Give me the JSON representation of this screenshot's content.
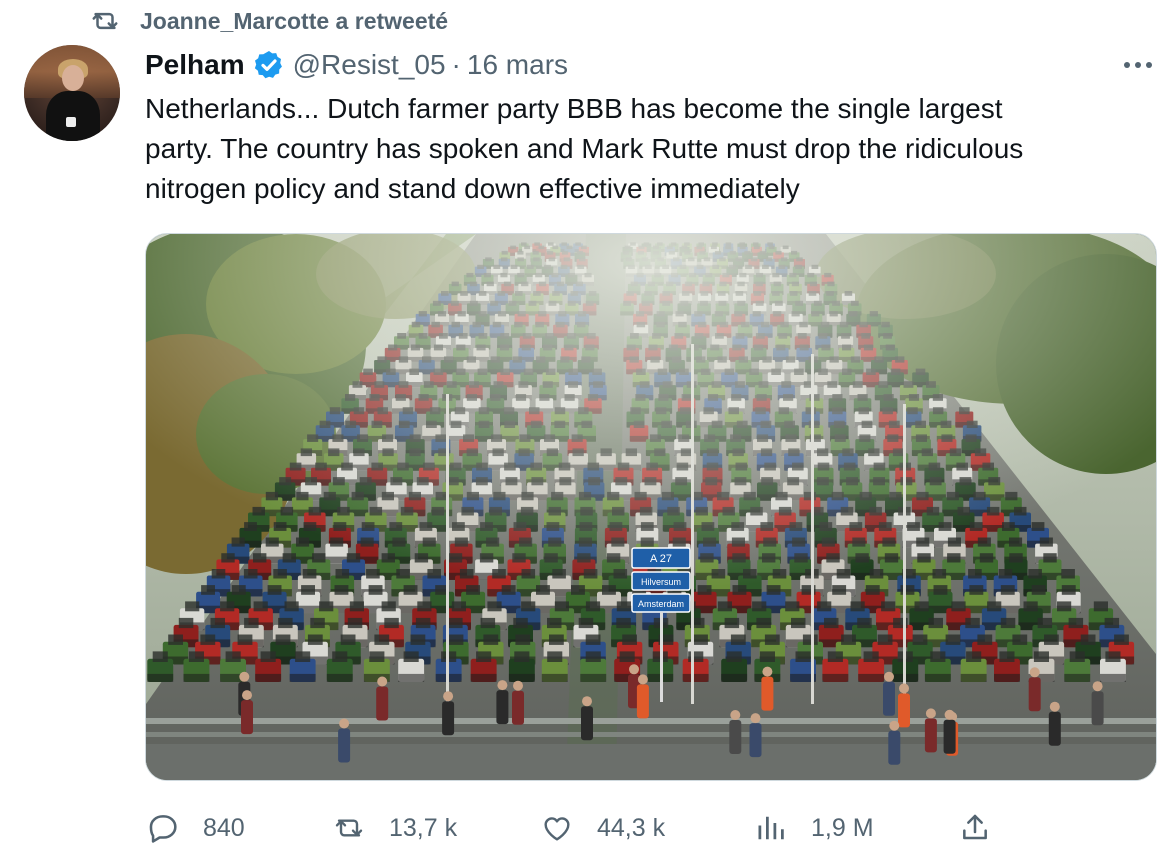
{
  "retweet_context": {
    "text": "Joanne_Marcotte a retweeté",
    "icon": "retweet-icon"
  },
  "author": {
    "display_name": "Pelham",
    "verified": true,
    "handle": "@Resist_05",
    "separator": "·",
    "date": "16 mars",
    "avatar": "avatar"
  },
  "tweet": {
    "text": "Netherlands... Dutch farmer party BBB has become the single largest\nparty. The country has spoken and Mark Rutte must drop the ridiculous\nnitrogen policy and stand down effective immediately"
  },
  "media": {
    "type": "photo",
    "sign_texts": [
      "A 27",
      "Hilversum",
      "Amsterdam"
    ]
  },
  "actions": {
    "reply": {
      "icon": "reply-icon",
      "count": "840"
    },
    "retweet": {
      "icon": "retweet-icon",
      "count": "13,7 k"
    },
    "like": {
      "icon": "heart-icon",
      "count": "44,3 k"
    },
    "views": {
      "icon": "views-icon",
      "count": "1,9 M"
    },
    "share": {
      "icon": "share-icon"
    }
  },
  "colors": {
    "text_primary": "#0f1419",
    "text_secondary": "#536471",
    "verified_blue": "#1d9bf0",
    "border": "#cfd9de",
    "sign_blue": "#1f5fa8"
  }
}
